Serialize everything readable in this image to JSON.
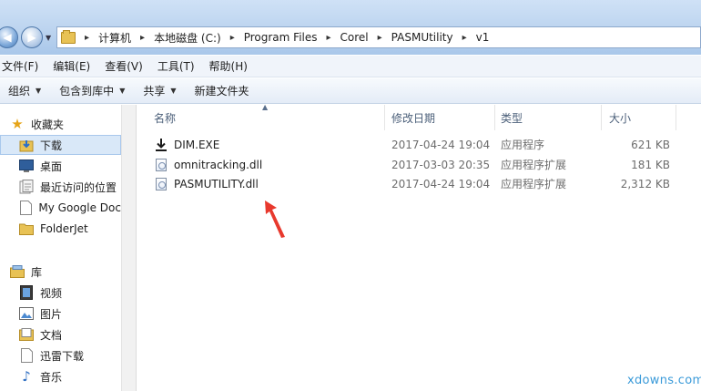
{
  "address": {
    "crumbs": [
      "计算机",
      "本地磁盘 (C:)",
      "Program Files",
      "Corel",
      "PASMUtility",
      "v1"
    ]
  },
  "menu": [
    "文件(F)",
    "编辑(E)",
    "查看(V)",
    "工具(T)",
    "帮助(H)"
  ],
  "toolbar": {
    "organize": "组织",
    "include_in_library": "包含到库中",
    "share": "共享",
    "new_folder": "新建文件夹"
  },
  "nav": {
    "favorites": "收藏夹",
    "downloads": "下载",
    "desktop": "桌面",
    "recent": "最近访问的位置",
    "google_drive": "My Google Doc",
    "folderjet": "FolderJet",
    "libraries": "库",
    "videos": "视频",
    "pictures": "图片",
    "documents": "文档",
    "thunder": "迅雷下载",
    "music": "音乐"
  },
  "columns": {
    "name": "名称",
    "modified": "修改日期",
    "type": "类型",
    "size": "大小"
  },
  "files": [
    {
      "name": "DIM.EXE",
      "modified": "2017-04-24 19:04",
      "type": "应用程序",
      "size": "621 KB",
      "icon": "download-arrow-icon"
    },
    {
      "name": "omnitracking.dll",
      "modified": "2017-03-03 20:35",
      "type": "应用程序扩展",
      "size": "181 KB",
      "icon": "dll-file-icon"
    },
    {
      "name": "PASMUTILITY.dll",
      "modified": "2017-04-24 19:04",
      "type": "应用程序扩展",
      "size": "2,312 KB",
      "icon": "dll-file-icon"
    }
  ],
  "watermark": "xdowns.com",
  "colors": {
    "selection": "#d9e8f8",
    "annotation_arrow": "#e8392d",
    "watermark": "#3a9ad9"
  }
}
